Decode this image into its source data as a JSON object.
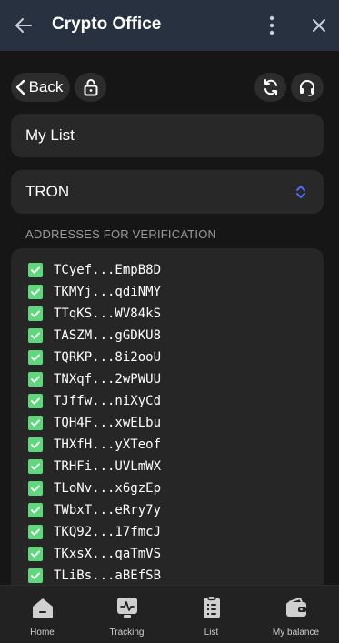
{
  "window": {
    "title": "Crypto Office"
  },
  "toolbar": {
    "back_label": "Back"
  },
  "form": {
    "list_name": "My List",
    "network": "TRON"
  },
  "addresses": {
    "section_label": "ADDRESSES FOR VERIFICATION",
    "items": [
      {
        "address": "TCyef...EmpB8D",
        "checked": true
      },
      {
        "address": "TKMYj...qdiNMY",
        "checked": true
      },
      {
        "address": "TTqKS...WV84kS",
        "checked": true
      },
      {
        "address": "TASZM...gGDKU8",
        "checked": true
      },
      {
        "address": "TQRKP...8i2ooU",
        "checked": true
      },
      {
        "address": "TNXqf...2wPWUU",
        "checked": true
      },
      {
        "address": "TJffw...niXyCd",
        "checked": true
      },
      {
        "address": "TQH4F...xwELbu",
        "checked": true
      },
      {
        "address": "THXfH...yXTeof",
        "checked": true
      },
      {
        "address": "TRHFi...UVLmWX",
        "checked": true
      },
      {
        "address": "TLoNv...x6gzEp",
        "checked": true
      },
      {
        "address": "TWbxT...eRry7y",
        "checked": true
      },
      {
        "address": "TKQ92...17fmcJ",
        "checked": true
      },
      {
        "address": "TKxsX...qaTmVS",
        "checked": true
      },
      {
        "address": "TLiBs...aBEfSB",
        "checked": true
      }
    ]
  },
  "nav": {
    "items": [
      {
        "label": "Home",
        "icon": "home-icon"
      },
      {
        "label": "Tracking",
        "icon": "tracking-icon"
      },
      {
        "label": "List",
        "icon": "list-icon"
      },
      {
        "label": "My balance",
        "icon": "wallet-icon"
      }
    ]
  },
  "colors": {
    "titlebar": "#273140",
    "checkbox": "#5dd87a",
    "accent_chevron": "#4a6cf7"
  }
}
